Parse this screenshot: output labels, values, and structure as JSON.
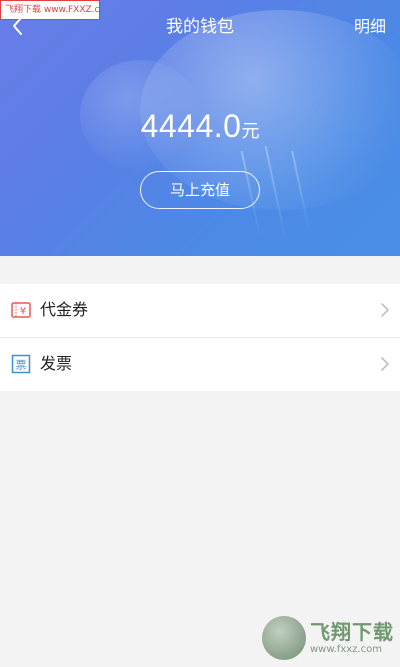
{
  "watermark": {
    "top_text": "飞翔下载 www.FXXZ.com",
    "bottom_name": "飞翔下载",
    "bottom_url": "www.fxxz.com"
  },
  "header": {
    "title": "我的钱包",
    "detail_label": "明细",
    "back_icon": "chevron-left-icon"
  },
  "balance": {
    "amount": "4444.0",
    "unit": "元"
  },
  "recharge_button": {
    "label": "马上充值"
  },
  "menu": {
    "items": [
      {
        "label": "代金券",
        "icon": "voucher-icon",
        "icon_text": "¥",
        "icon_color": "#e85a4f"
      },
      {
        "label": "发票",
        "icon": "invoice-icon",
        "icon_text": "票",
        "icon_color": "#3d8fd6"
      }
    ]
  },
  "colors": {
    "header_gradient_start": "#6a7ce8",
    "header_gradient_end": "#4a8fe7",
    "background": "#f3f3f3"
  }
}
